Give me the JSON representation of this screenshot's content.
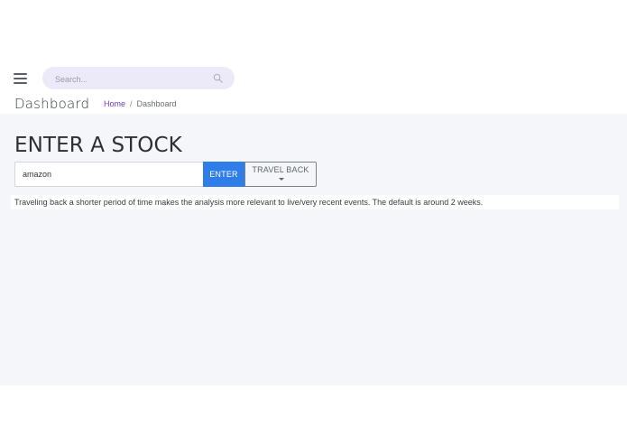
{
  "header": {
    "menu_icon": "hamburger-menu-icon",
    "search": {
      "placeholder": "Search...",
      "value": "",
      "icon": "search-icon"
    }
  },
  "title_bar": {
    "title": "Dashboard",
    "breadcrumb": {
      "home": "Home",
      "separator": "/",
      "current": "Dashboard"
    }
  },
  "main": {
    "heading": "ENTER A STOCK",
    "stock_input": {
      "value": "amazon",
      "placeholder": ""
    },
    "enter_label": "ENTER",
    "travel_back_label": "TRAVEL BACK",
    "note": "Traveling back a shorter period of time makes the analysis more relevant to live/very recent events. The default is around 2 weeks."
  },
  "colors": {
    "accent_blue": "#2e7de8",
    "link_purple": "#6f3cc4",
    "search_bg": "#eceaf8",
    "content_bg": "#f4f6fa"
  }
}
